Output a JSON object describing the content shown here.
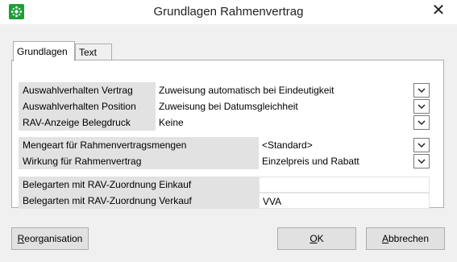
{
  "window": {
    "title": "Grundlagen Rahmenvertrag",
    "close_icon": "close-icon",
    "app_icon": "app-logo-icon"
  },
  "tabs": [
    {
      "label": "Grundlagen",
      "active": true
    },
    {
      "label": "Text",
      "active": false
    }
  ],
  "group1": {
    "rows": [
      {
        "label": "Auswahlverhalten Vertrag",
        "value": "Zuweisung automatisch bei Eindeutigkeit"
      },
      {
        "label": "Auswahlverhalten Position",
        "value": "Zuweisung bei Datumsgleichheit"
      },
      {
        "label": "RAV-Anzeige Belegdruck",
        "value": "Keine"
      }
    ]
  },
  "group2": {
    "rows": [
      {
        "label": "Mengeart für Rahmenvertragsmengen",
        "value": "<Standard>"
      },
      {
        "label": "Wirkung für Rahmenvertrag",
        "value": "Einzelpreis und Rabatt"
      }
    ]
  },
  "group3": {
    "rows": [
      {
        "label": "Belegarten mit RAV-Zuordnung Einkauf",
        "value": ""
      },
      {
        "label": "Belegarten mit RAV-Zuordnung Verkauf",
        "value": "VVA"
      }
    ]
  },
  "buttons": {
    "reorg": {
      "first": "R",
      "rest": "eorganisation"
    },
    "ok": {
      "first": "O",
      "rest": "K"
    },
    "cancel": {
      "first": "A",
      "rest": "bbrechen"
    }
  }
}
